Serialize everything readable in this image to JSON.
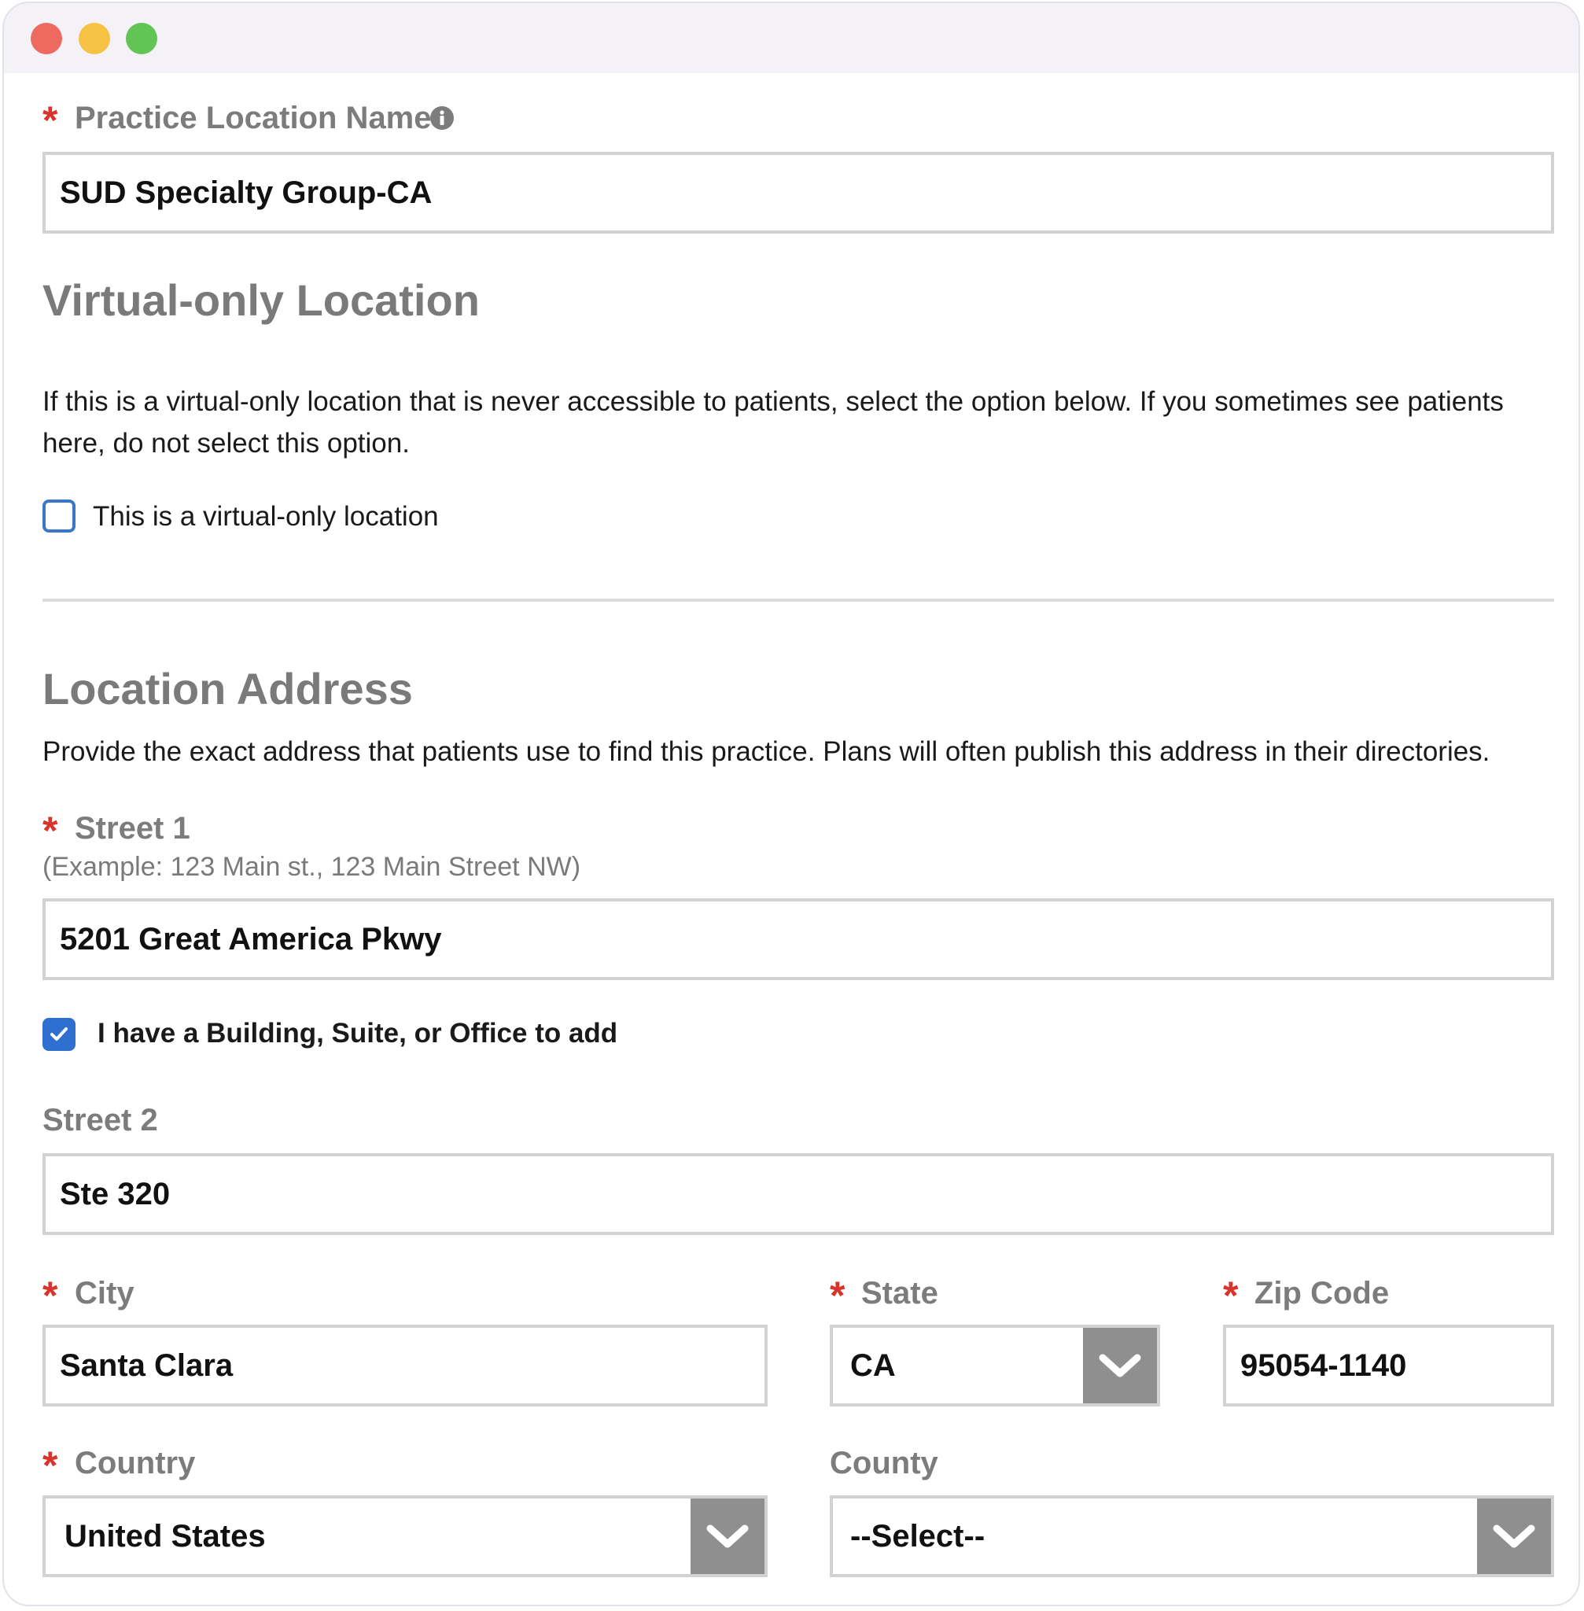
{
  "window": {
    "controls": [
      "close",
      "minimize",
      "maximize"
    ]
  },
  "practice_location": {
    "required_mark": "*",
    "label": "Practice Location Name",
    "info_icon": "info-circle-icon",
    "value": "SUD Specialty Group-CA"
  },
  "virtual_only": {
    "title": "Virtual-only Location",
    "description": "If this is a virtual-only location that is never accessible to patients, select the option below. If you sometimes see patients here, do not select this option.",
    "checkbox_label": "This is a virtual-only location",
    "checked": false
  },
  "address": {
    "title": "Location Address",
    "description": "Provide the exact address that patients use to find this practice. Plans will often publish this address in their directories.",
    "street1": {
      "required_mark": "*",
      "label": "Street 1",
      "hint": "(Example: 123 Main st., 123 Main Street NW)",
      "value": "5201 Great America Pkwy"
    },
    "suite_checkbox": {
      "label": "I have a Building, Suite, or Office to add",
      "checked": true
    },
    "street2": {
      "label": "Street 2",
      "value": "Ste 320"
    },
    "city": {
      "required_mark": "*",
      "label": "City",
      "value": "Santa Clara"
    },
    "state": {
      "required_mark": "*",
      "label": "State",
      "value": "CA"
    },
    "zip": {
      "required_mark": "*",
      "label": "Zip Code",
      "value": "95054-1140"
    },
    "country": {
      "required_mark": "*",
      "label": "Country",
      "value": "United States"
    },
    "county": {
      "label": "County",
      "value": "--Select--"
    }
  },
  "colors": {
    "required": "#d9342b",
    "label": "#7c7c7c",
    "checkbox_blue": "#2f6fd0",
    "field_border": "#d2d2d2",
    "select_arrow_bg": "#8f8f8f"
  }
}
